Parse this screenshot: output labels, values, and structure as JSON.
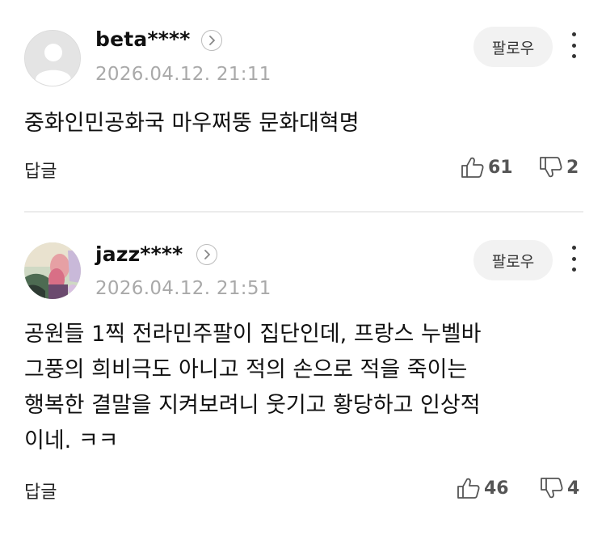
{
  "comments": [
    {
      "username": "beta****",
      "date": "2026.04.12. 21:11",
      "follow_label": "팔로우",
      "text": "중화인민공화국 마우쩌뚱 문화대혁명",
      "reply_label": "답글",
      "likes": "61",
      "dislikes": "2"
    },
    {
      "username": "jazz****",
      "date": "2026.04.12. 21:51",
      "follow_label": "팔로우",
      "text": "공원들 1찍 전라민주팔이 집단인데, 프랑스 누벨바\n그풍의 희비극도 아니고 적의 손으로 적을 죽이는\n행복한 결말을 지켜보려니 웃기고 황당하고 인상적\n이네. ㅋㅋ",
      "reply_label": "답글",
      "likes": "46",
      "dislikes": "4"
    }
  ],
  "icons": {
    "profile_arrow": "chevron-right-icon",
    "more": "more-vertical-icon",
    "like": "thumbs-up-icon",
    "dislike": "thumbs-down-icon"
  },
  "colors": {
    "date_gray": "#a9a9a9",
    "follow_bg": "#f2f2f2",
    "divider": "#ececec"
  }
}
